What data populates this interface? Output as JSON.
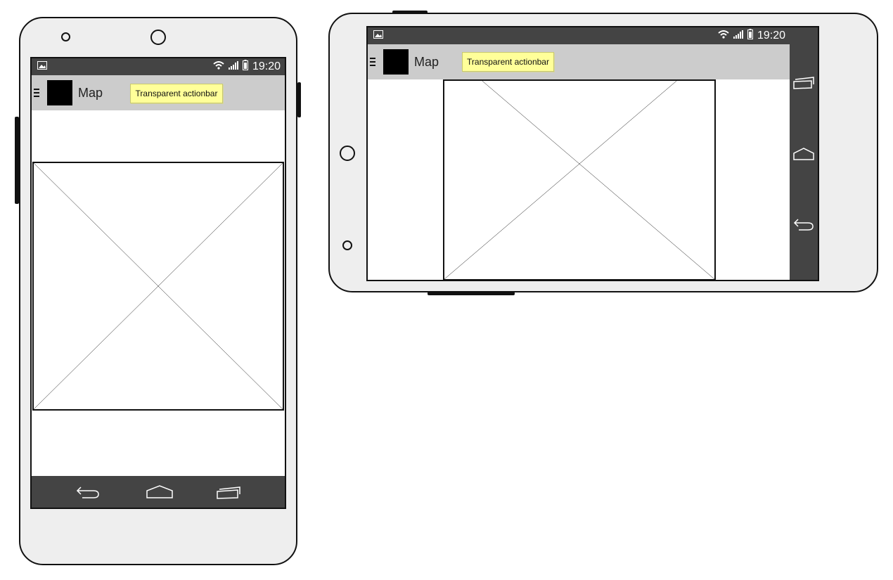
{
  "portrait": {
    "status_bar": {
      "time": "19:20",
      "icons": [
        "image-icon",
        "wifi-icon",
        "signal-icon",
        "battery-icon"
      ]
    },
    "action_bar": {
      "menu_icon": "hamburger-icon",
      "title": "Map"
    },
    "note": "Transparent actionbar",
    "content": {
      "placeholder": "image-placeholder"
    },
    "nav_bar": {
      "buttons": [
        "back-icon",
        "home-icon",
        "recents-icon"
      ]
    }
  },
  "landscape": {
    "status_bar": {
      "time": "19:20",
      "icons": [
        "image-icon",
        "wifi-icon",
        "signal-icon",
        "battery-icon"
      ]
    },
    "action_bar": {
      "menu_icon": "hamburger-icon",
      "title": "Map"
    },
    "note": "Transparent actionbar",
    "content": {
      "placeholder": "image-placeholder"
    },
    "nav_bar": {
      "buttons": [
        "recents-icon",
        "home-icon",
        "back-icon"
      ]
    }
  },
  "colors": {
    "device_body": "#eeeeee",
    "system_bars": "#444444",
    "action_bar": "#cccccc",
    "note": "#ffff99",
    "outline": "#111111"
  }
}
